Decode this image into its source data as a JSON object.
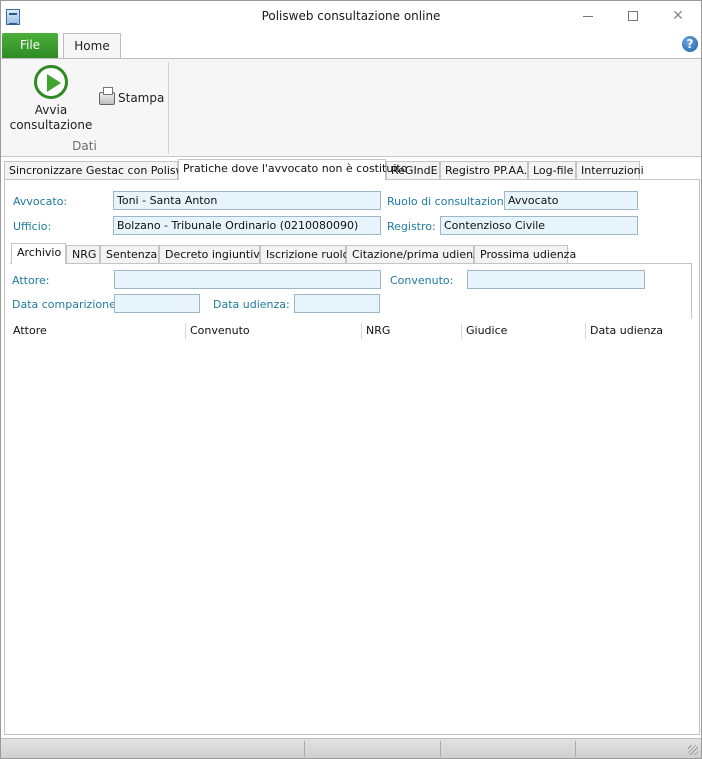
{
  "window": {
    "title": "Polisweb consultazione online"
  },
  "ribbon": {
    "file_label": "File",
    "home_label": "Home",
    "avvia_label_line1": "Avvia",
    "avvia_label_line2": "consultazione",
    "stampa_label": "Stampa",
    "group_label": "Dati"
  },
  "main_tabs": [
    "Sincronizzare Gestac con Polisweb",
    "Pratiche dove l'avvocato non è costituito",
    "ReGIndE",
    "Registro PP.AA.",
    "Log-file",
    "Interruzioni"
  ],
  "form": {
    "avvocato_label": "Avvocato:",
    "avvocato_value": "Toni - Santa Anton",
    "ruolo_label": "Ruolo di consultazione:",
    "ruolo_value": "Avvocato",
    "ufficio_label": "Ufficio:",
    "ufficio_value": "Bolzano - Tribunale Ordinario (0210080090)",
    "registro_label": "Registro:",
    "registro_value": "Contenzioso Civile"
  },
  "sub_tabs": [
    "Archivio",
    "NRG",
    "Sentenza",
    "Decreto ingiuntivo",
    "Iscrizione ruolo",
    "Citazione/prima udienza",
    "Prossima udienza"
  ],
  "filters": {
    "attore_label": "Attore:",
    "attore_value": "",
    "convenuto_label": "Convenuto:",
    "convenuto_value": "",
    "data_comparizione_label": "Data comparizione:",
    "data_comparizione_value": "",
    "data_udienza_label": "Data udienza:",
    "data_udienza_value": ""
  },
  "grid": {
    "columns": [
      "Attore",
      "Convenuto",
      "NRG",
      "Giudice",
      "Data udienza"
    ],
    "rows": []
  },
  "colors": {
    "accent_green": "#2e8b22",
    "label_teal": "#1f7a9e",
    "field_bg": "#e8f4fb"
  }
}
